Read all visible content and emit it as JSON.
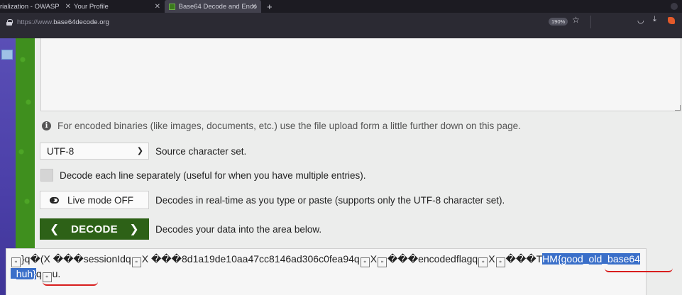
{
  "browser": {
    "tabs": [
      {
        "label": "rialization - OWASP"
      },
      {
        "label": "Your Profile"
      },
      {
        "label": "Base64 Decode and Enco"
      }
    ],
    "url_proto": "https://www.",
    "url_host": "base64decode.org",
    "zoom": "190%"
  },
  "page": {
    "info_text": "For encoded binaries (like images, documents, etc.) use the file upload form a little further down on this page.",
    "charset_value": "UTF-8",
    "charset_label": "Source character set.",
    "lines_label": "Decode each line separately (useful for when you have multiple entries).",
    "live_label": "Live mode OFF",
    "live_desc": "Decodes in real-time as you type or paste (supports only the UTF-8 character set).",
    "decode_label": "DECODE",
    "decode_desc": "Decodes your data into the area below.",
    "output": {
      "p1": "}q�(X  ���sessionIdq",
      "p2": "X ���8d1a19de10aa47cc8146ad306c0fea94q",
      "p3": "X",
      "p4": "���encodedflagq",
      "p5": "X",
      "p6": "���T",
      "flag_part1": "HM{good_old_b",
      "flag_part2": "ase64_huh}",
      "p7": "q",
      "p8": "u."
    }
  }
}
